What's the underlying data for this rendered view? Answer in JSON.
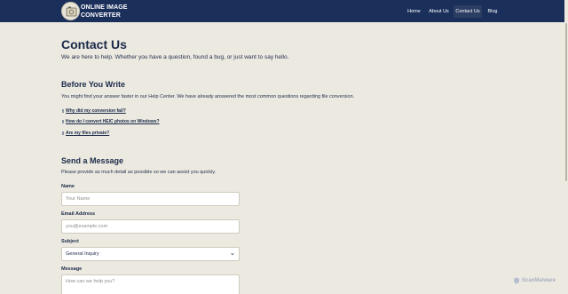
{
  "header": {
    "brand_line1": "Online Image",
    "brand_line2": "Converter",
    "nav": [
      {
        "label": "Home",
        "active": false
      },
      {
        "label": "About Us",
        "active": false
      },
      {
        "label": "Contact Us",
        "active": true
      },
      {
        "label": "Blog",
        "active": false
      }
    ]
  },
  "page": {
    "title": "Contact Us",
    "lead": "We are here to help. Whether you have a question, found a bug, or just want to say hello."
  },
  "before_you_write": {
    "heading": "Before You Write",
    "text": "You might find your answer faster in our Help Center. We have already answered the most common questions regarding file conversion.",
    "links": [
      "Why did my conversion fail?",
      "How do I convert HEIC photos on Windows?",
      "Are my files private?"
    ]
  },
  "send_message": {
    "heading": "Send a Message",
    "text": "Please provide as much detail as possible so we can assist you quickly.",
    "name_label": "Name",
    "name_placeholder": "Your Name",
    "email_label": "Email Address",
    "email_placeholder": "you@example.com",
    "subject_label": "Subject",
    "subject_value": "General Inquiry",
    "message_label": "Message",
    "message_placeholder": "How can we help you?"
  },
  "watermark": "ScanMalware",
  "colors": {
    "header_bg": "#1b2f5b",
    "page_bg": "#ece9e1",
    "text": "#1a2a48"
  }
}
